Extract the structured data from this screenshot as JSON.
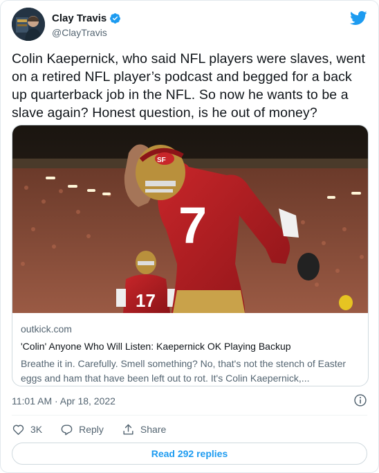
{
  "author": {
    "name": "Clay Travis",
    "handle": "@ClayTravis",
    "verified_icon": "verified-badge-icon",
    "avatar_icon": "avatar"
  },
  "brand": {
    "icon": "twitter-bird-icon",
    "color": "#1d9bf0"
  },
  "tweet": {
    "text": "Colin Kaepernick, who said NFL players were slaves, went on a retired NFL player’s podcast and begged for a back up quarterback job in the NFL. So now he wants to be a slave again? Honest question, is he out of money?"
  },
  "link_card": {
    "domain": "outkick.com",
    "title": "'Colin' Anyone Who Will Listen: Kaepernick OK Playing Backup",
    "description": "Breathe it in. Carefully. Smell something? No, that's not the stench of Easter eggs and ham that have been left out to rot. It's Colin Kaepernick,...",
    "image": "football-player-photo"
  },
  "meta": {
    "timestamp": "11:01 AM · Apr 18, 2022",
    "info_icon": "info-icon"
  },
  "actions": {
    "like_count": "3K",
    "reply_label": "Reply",
    "share_label": "Share"
  },
  "read_replies_label": "Read 292 replies",
  "colors": {
    "text": "#0f1419",
    "secondary": "#536471",
    "accent": "#1d9bf0",
    "border": "#cfd9de"
  }
}
